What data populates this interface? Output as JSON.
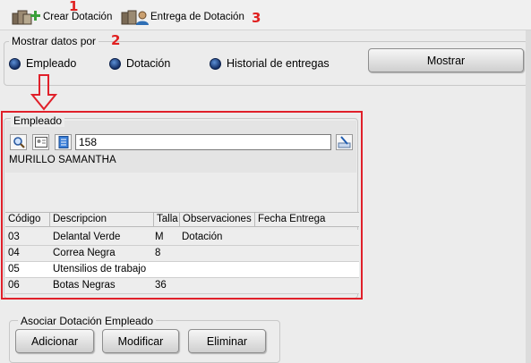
{
  "toolbar": {
    "crear_label": "Crear Dotación",
    "crear_marker": "1",
    "entrega_label": "Entrega de Dotación",
    "entrega_marker": "3"
  },
  "mostrar_datos": {
    "legend": "Mostrar datos por",
    "marker": "2",
    "options": [
      "Empleado",
      "Dotación",
      "Historial de entregas"
    ],
    "button_label": "Mostrar"
  },
  "empleado": {
    "legend": "Empleado",
    "code_value": "158",
    "name": "MURILLO  SAMANTHA"
  },
  "table": {
    "headers": [
      "Código",
      "Descripcion",
      "Talla",
      "Observaciones",
      "Fecha Entrega"
    ],
    "rows": [
      [
        "03",
        "Delantal Verde",
        "M",
        "Dotación",
        ""
      ],
      [
        "04",
        "Correa Negra",
        "8",
        "",
        ""
      ],
      [
        "05",
        "Utensilios de trabajo",
        "",
        "",
        ""
      ],
      [
        "06",
        "Botas Negras",
        "36",
        "",
        ""
      ]
    ]
  },
  "asociar": {
    "legend": "Asociar Dotación Empleado",
    "buttons": [
      "Adicionar",
      "Modificar",
      "Eliminar"
    ]
  },
  "colors": {
    "annotation_red": "#e0202a",
    "radio_blue": "#1f4b9a"
  },
  "icons": [
    "boxes-add-icon",
    "boxes-person-icon",
    "search-icon",
    "id-card-icon",
    "document-icon",
    "clear-field-icon",
    "down-arrow-icon"
  ]
}
